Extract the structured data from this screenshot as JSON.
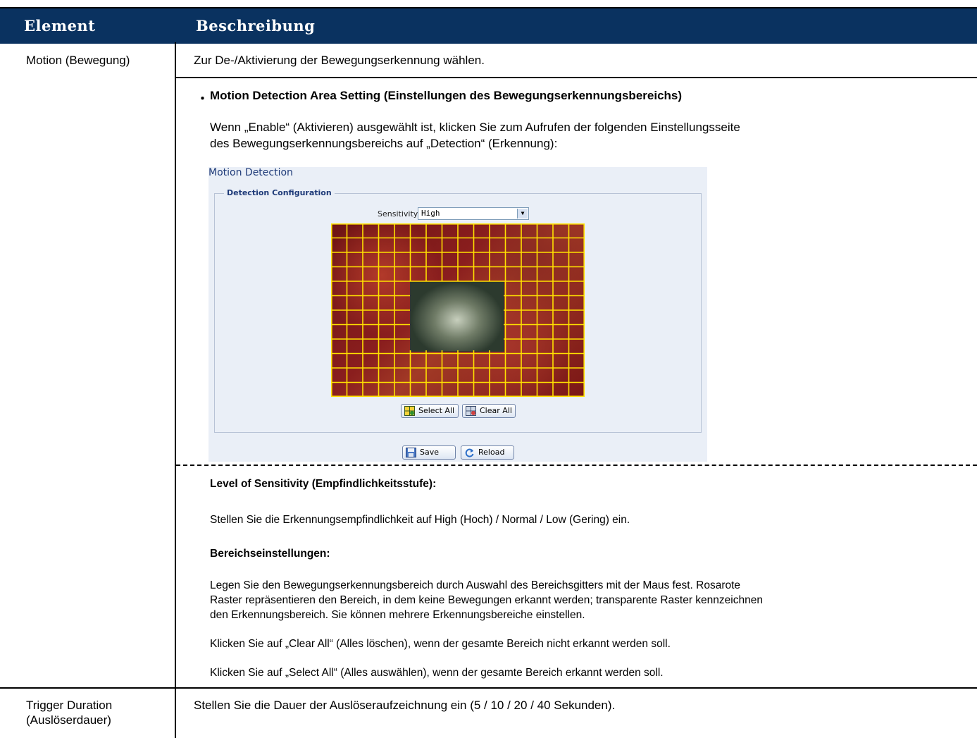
{
  "header": {
    "col1": "Element",
    "col2": "Beschreibung"
  },
  "rows": [
    {
      "element": "Motion (Bewegung)",
      "description": "Zur De-/Aktivierung der Bewegungserkennung wählen."
    },
    {
      "element_line1": "Trigger Duration",
      "element_line2": "(Auslöserdauer)",
      "description": "Stellen Sie die Dauer der Auslöseraufzeichnung ein (5 / 10 / 20 / 40 Sekunden)."
    }
  ],
  "area_setting": {
    "bullet": "・",
    "heading": "Motion Detection Area Setting (Einstellungen des Bewegungserkennungsbereichs)",
    "intro_line1": "Wenn „Enable“ (Aktivieren) ausgewählt ist, klicken Sie zum Aufrufen der folgenden Einstellungsseite",
    "intro_line2": "des Bewegungserkennungsbereichs auf „Detection“ (Erkennung):"
  },
  "panel": {
    "title": "Motion Detection",
    "legend": "Detection Configuration",
    "sensitivity_label": "Sensitivity:",
    "sensitivity_value": "High",
    "select_all": "Select All",
    "clear_all": "Clear All",
    "save": "Save",
    "reload": "Reload"
  },
  "details": {
    "sens_heading": "Level of Sensitivity (Empfindlichkeitsstufe):",
    "sens_text": "Stellen Sie die Erkennungsempfindlichkeit auf High (Hoch) / Normal / Low (Gering) ein.",
    "area_heading": "Bereichseinstellungen:",
    "area_text_1": "Legen Sie den Bewegungserkennungsbereich durch Auswahl des Bereichsgitters mit der Maus fest. Rosarote",
    "area_text_2": "Raster repräsentieren den Bereich, in dem keine Bewegungen erkannt werden; transparente Raster kennzeichnen",
    "area_text_3": "den Erkennungsbereich. Sie können mehrere Erkennungsbereiche einstellen.",
    "clear_text": "Klicken Sie auf „Clear All“ (Alles löschen), wenn der gesamte Bereich nicht erkannt werden soll.",
    "select_text": "Klicken Sie auf „Select All“ (Alles auswählen), wenn der gesamte Bereich erkannt werden soll."
  },
  "colors": {
    "header_bg": "#0a3260",
    "grid_line": "#ffe100"
  }
}
